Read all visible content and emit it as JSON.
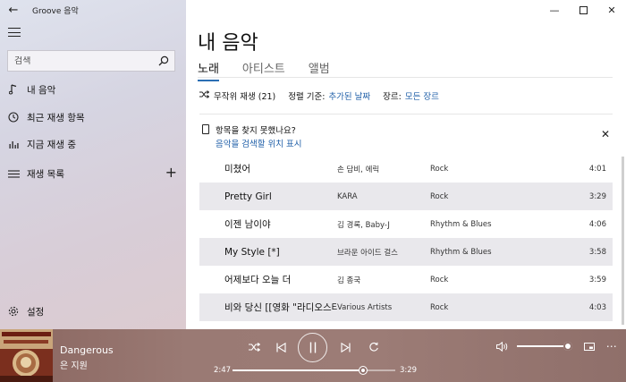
{
  "app": {
    "title": "Groove 음악"
  },
  "sidebar": {
    "search": {
      "placeholder": "검색"
    },
    "items": [
      {
        "label": "내 음악",
        "icon": "music-note-icon"
      },
      {
        "label": "최근 재생 항목",
        "icon": "clock-icon"
      },
      {
        "label": "지금 재생 중",
        "icon": "equalizer-icon"
      },
      {
        "label": "재생 목록",
        "icon": "playlist-icon"
      }
    ],
    "settings": {
      "label": "설정",
      "icon": "gear-icon"
    }
  },
  "main": {
    "title": "내 음악",
    "tabs": [
      {
        "label": "노래",
        "active": true
      },
      {
        "label": "아티스트",
        "active": false
      },
      {
        "label": "앨범",
        "active": false
      }
    ],
    "filters": {
      "shuffle": "무작위 재생 (21)",
      "sort_label": "정렬 기준:",
      "sort_value": "추가된 날짜",
      "genre_label": "장르:",
      "genre_value": "모든 장르"
    },
    "notice": {
      "title": "항목을 찾지 못했나요?",
      "link": "음악을 검색할 위치 표시"
    },
    "songs": [
      {
        "title": "미쳤어",
        "artist": "손 담비, 에릭",
        "genre": "Rock",
        "duration": "4:01"
      },
      {
        "title": "Pretty Girl",
        "artist": "KARA",
        "genre": "Rock",
        "duration": "3:29"
      },
      {
        "title": "이젠 남이야",
        "artist": "김 경록, Baby-J",
        "genre": "Rhythm & Blues",
        "duration": "4:06"
      },
      {
        "title": "My Style [*]",
        "artist": "브라운 아이드 걸스",
        "genre": "Rhythm & Blues",
        "duration": "3:58"
      },
      {
        "title": "어제보다 오늘 더",
        "artist": "김 종국",
        "genre": "Rock",
        "duration": "3:59"
      },
      {
        "title": "비와 당신 [[영화 \"라디오스타\"]]",
        "artist": "Various Artists",
        "genre": "Rock",
        "duration": "4:03"
      }
    ]
  },
  "player": {
    "title": "Dangerous",
    "artist": "은 지원",
    "elapsed": "2:47",
    "total": "3:29",
    "progress": 0.8,
    "volume": 0.98,
    "accent": "#8f6f6a"
  }
}
